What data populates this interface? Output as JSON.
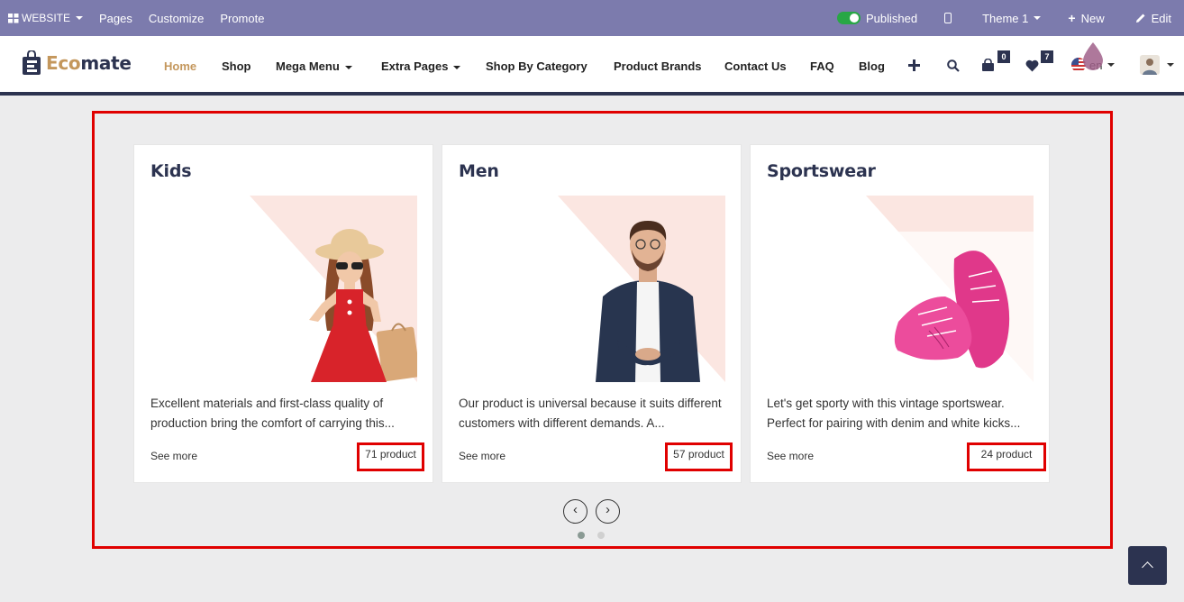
{
  "adminbar": {
    "website": "WEBSITE",
    "pages": "Pages",
    "customize": "Customize",
    "promote": "Promote",
    "published": "Published",
    "theme": "Theme 1",
    "new": "New",
    "edit": "Edit"
  },
  "navbar": {
    "logo_a": "Eco",
    "logo_b": "mate",
    "links": [
      "Home",
      "Shop",
      "Mega Menu",
      "Extra Pages",
      "Shop By Category",
      "Product Brands",
      "Contact Us",
      "FAQ",
      "Blog"
    ],
    "cart_count": "0",
    "wishlist_count": "7",
    "language": "en"
  },
  "cards": [
    {
      "title": "Kids",
      "desc": "Excellent materials and first-class quality of production bring the comfort of carrying this...",
      "see_more": "See more",
      "count": "71 product"
    },
    {
      "title": "Men",
      "desc": "Our product is universal because it suits different customers with different demands. A...",
      "see_more": "See more",
      "count": "57 product"
    },
    {
      "title": "Sportswear",
      "desc": "Let's get sporty with this vintage sportswear. Perfect for pairing with denim and white kicks...",
      "see_more": "See more",
      "count": "24 product"
    }
  ],
  "carousel": {
    "prev": "‹",
    "next": "›"
  },
  "colors": {
    "admin": "#7c7bad",
    "brand": "#2c3350",
    "accent": "#c4975c",
    "highlight": "#e00000"
  }
}
